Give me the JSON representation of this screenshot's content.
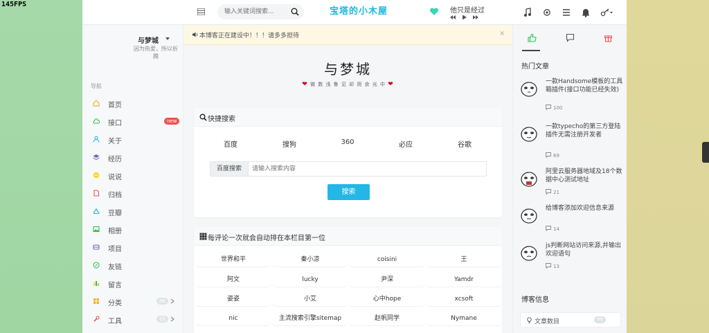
{
  "overlay": {
    "fps": "145FPS"
  },
  "header": {
    "search_placeholder": "输入关键词搜索...",
    "logo": "宝塔的小木屋",
    "music_title": "他只是经过"
  },
  "sidebar": {
    "author": "与梦城",
    "motto": "因为热爱，所以折腾",
    "nav_heading": "导航",
    "items": [
      {
        "label": "首页",
        "icon": "home-icon",
        "color": "#f0b429"
      },
      {
        "label": "接口",
        "icon": "cloud-icon",
        "color": "#27c24c",
        "badge": "new"
      },
      {
        "label": "关于",
        "icon": "user-icon",
        "color": "#23b7e5"
      },
      {
        "label": "经历",
        "icon": "layers-icon",
        "color": "#7266ba"
      },
      {
        "label": "说说",
        "icon": "chat-icon",
        "color": "#fad733"
      },
      {
        "label": "归档",
        "icon": "archive-icon",
        "color": "#f05050"
      },
      {
        "label": "豆瓣",
        "icon": "douban-icon",
        "color": "#23b7e5"
      },
      {
        "label": "相册",
        "icon": "image-icon",
        "color": "#27c24c"
      },
      {
        "label": "项目",
        "icon": "project-icon",
        "color": "#7266ba"
      },
      {
        "label": "友链",
        "icon": "link-icon",
        "color": "#27c24c"
      },
      {
        "label": "留言",
        "icon": "message-icon",
        "color": "#fad733"
      },
      {
        "label": "分类",
        "icon": "category-icon",
        "color": "#f0b429",
        "badge": "36"
      },
      {
        "label": "工具",
        "icon": "tool-icon",
        "color": "#f05050",
        "badge": "15"
      }
    ]
  },
  "notice": {
    "text": "本博客正在建设中！！！请多多担待",
    "close": "×"
  },
  "site": {
    "title": "与梦城",
    "subtitle": "微 数 浅 鲁 见 却 用 余 光 中"
  },
  "quick_search": {
    "title": "快捷搜索",
    "engines": [
      "百度",
      "搜狗",
      "360",
      "必应",
      "谷歌"
    ],
    "prefix": "百度搜索",
    "placeholder": "请输入搜索内容",
    "button": "搜索"
  },
  "commenters": {
    "title": "每评论一次就会自动排在本栏目第一位",
    "names": [
      "世界和平",
      "秦小凉",
      "coisini",
      "王",
      "阿文",
      "lucky",
      "尹深",
      "Yamdr",
      "姿姿",
      "小艾",
      "心中hope",
      "xcsoft",
      "nic",
      "主流搜索引擎sitemap",
      "赵帆同学",
      "Nymane"
    ]
  },
  "right": {
    "hot_title": "热门文章",
    "posts": [
      {
        "title": "一款Handsome模板的工具箱插件(接口功能已经失效)",
        "comments": "100"
      },
      {
        "title": "一款typecho的第三方登陆插件无需注册开发者",
        "comments": "69"
      },
      {
        "title": "阿里云服务器地域及18个数据中心测试地址",
        "comments": "21"
      },
      {
        "title": "给博客添加欢迎信息来源",
        "comments": "14"
      },
      {
        "title": "js判断网站访问来源,并输出欢迎语句",
        "comments": "13"
      }
    ],
    "blog_info_title": "博客信息",
    "blog_info": [
      {
        "label": "文章数目",
        "value": "96"
      }
    ]
  }
}
